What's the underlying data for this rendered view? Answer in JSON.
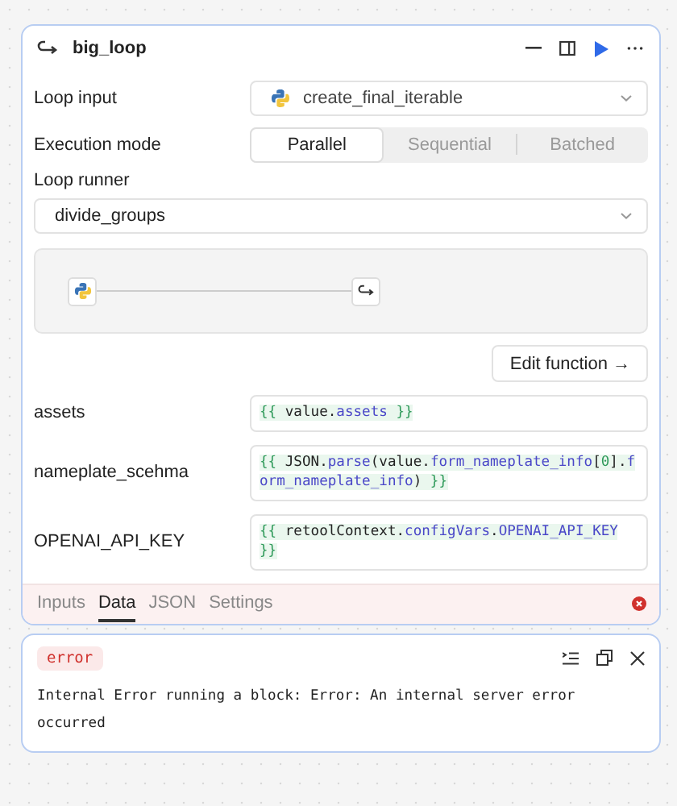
{
  "block": {
    "title": "big_loop",
    "fields": [
      {
        "kind": "select",
        "label": "Loop input",
        "value": "create_final_iterable",
        "python": true
      },
      {
        "kind": "segmented",
        "label": "Execution mode",
        "options": [
          {
            "label": "Parallel",
            "selected": true
          },
          {
            "label": "Sequential",
            "selected": false
          },
          {
            "label": "Batched",
            "selected": false
          }
        ]
      }
    ],
    "loop_runner": {
      "label": "Loop runner",
      "value": "divide_groups"
    },
    "edit_button": "Edit function →",
    "params": [
      {
        "name": "assets",
        "code": [
          {
            "kind": "brace",
            "text": "{{ "
          },
          {
            "kind": "plain",
            "text": "value."
          },
          {
            "kind": "prop",
            "text": "assets"
          },
          {
            "kind": "brace",
            "text": " }}"
          }
        ]
      },
      {
        "name": "nameplate_scehma",
        "code": [
          {
            "kind": "brace",
            "text": "{{ "
          },
          {
            "kind": "plain",
            "text": "JSON."
          },
          {
            "kind": "prop",
            "text": "parse"
          },
          {
            "kind": "plain",
            "text": "(value."
          },
          {
            "kind": "prop",
            "text": "form_nameplate_info"
          },
          {
            "kind": "plain",
            "text": "["
          },
          {
            "kind": "num",
            "text": "0"
          },
          {
            "kind": "plain",
            "text": "]."
          },
          {
            "kind": "prop",
            "text": "form_nameplate_info"
          },
          {
            "kind": "plain",
            "text": ")"
          },
          {
            "kind": "brace",
            "text": " }}"
          }
        ]
      },
      {
        "name": "OPENAI_API_KEY",
        "code": [
          {
            "kind": "brace",
            "text": "{{ "
          },
          {
            "kind": "plain",
            "text": "retoolContext."
          },
          {
            "kind": "prop",
            "text": "configVars"
          },
          {
            "kind": "plain",
            "text": "."
          },
          {
            "kind": "prop",
            "text": "OPENAI_API_KEY"
          },
          {
            "kind": "brace",
            "text": " }}"
          }
        ]
      }
    ],
    "tabs": [
      {
        "label": "Inputs",
        "selected": false
      },
      {
        "label": "Data",
        "selected": true
      },
      {
        "label": "JSON",
        "selected": false
      },
      {
        "label": "Settings",
        "selected": false
      }
    ],
    "has_error": true
  },
  "error_panel": {
    "badge": "error",
    "message": "Internal Error running a block: Error: An internal server error occurred"
  }
}
